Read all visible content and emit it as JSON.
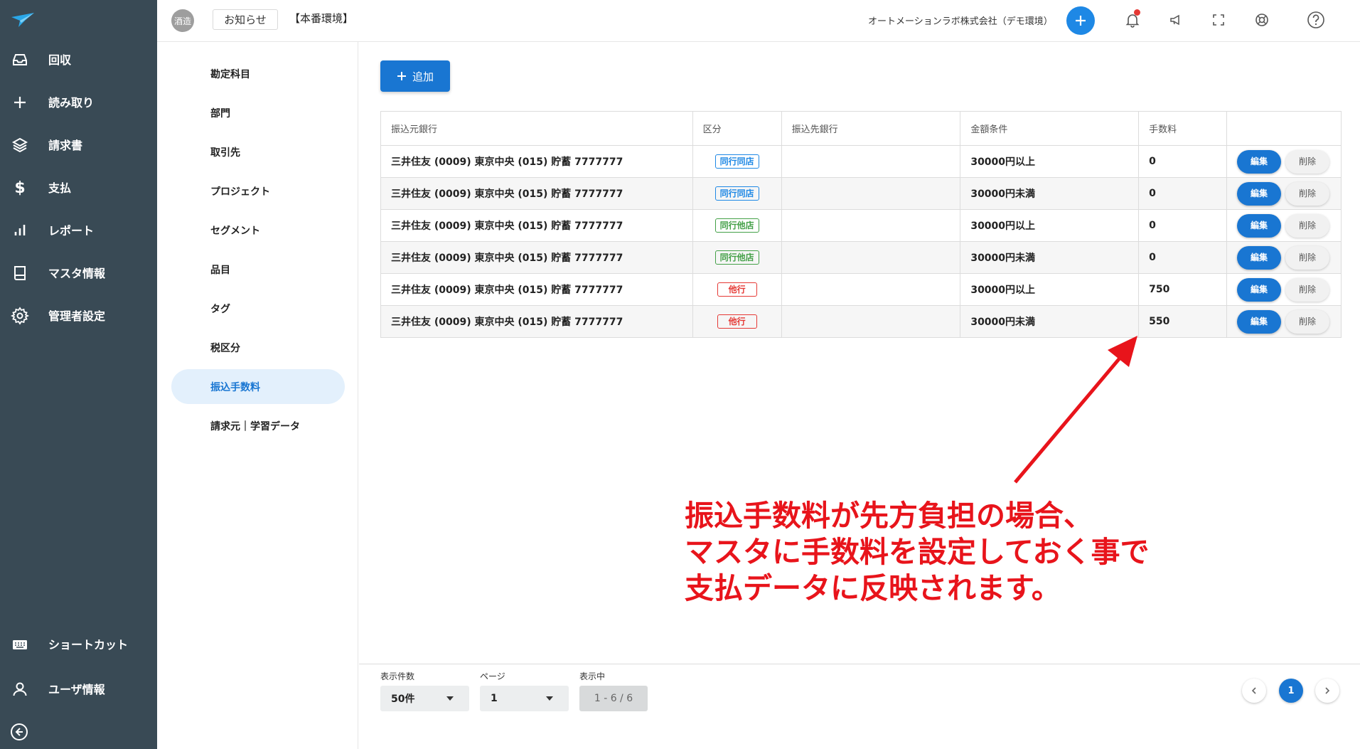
{
  "sidebar": {
    "items": [
      {
        "label": "回収",
        "icon": "inbox-icon"
      },
      {
        "label": "読み取り",
        "icon": "plus-icon"
      },
      {
        "label": "請求書",
        "icon": "layers-icon"
      },
      {
        "label": "支払",
        "icon": "dollar-icon"
      },
      {
        "label": "レポート",
        "icon": "bar-chart-icon"
      },
      {
        "label": "マスタ情報",
        "icon": "book-icon"
      },
      {
        "label": "管理者設定",
        "icon": "gear-icon"
      }
    ],
    "bottom_items": [
      {
        "label": "ショートカット",
        "icon": "keyboard-icon"
      },
      {
        "label": "ユーザ情報",
        "icon": "user-icon"
      }
    ]
  },
  "header": {
    "org_avatar": "酒造",
    "notice_label": "お知らせ",
    "environment": "【本番環境】",
    "company": "オートメーションラボ株式会社（デモ環境）"
  },
  "submenu": {
    "items": [
      {
        "label": "勘定科目"
      },
      {
        "label": "部門"
      },
      {
        "label": "取引先"
      },
      {
        "label": "プロジェクト"
      },
      {
        "label": "セグメント"
      },
      {
        "label": "品目"
      },
      {
        "label": "タグ"
      },
      {
        "label": "税区分"
      },
      {
        "label": "振込手数料"
      },
      {
        "label": "請求元｜学習データ"
      }
    ],
    "active_index": 8
  },
  "main": {
    "add_label": "追加",
    "table": {
      "headers": [
        "振込元銀行",
        "区分",
        "振込先銀行",
        "金額条件",
        "手数料",
        ""
      ],
      "rows": [
        {
          "source_bank": "三井住友 (0009) 東京中央 (015) 貯蓄 7777777",
          "category": "同行同店",
          "category_color": "blue",
          "dest_bank": "",
          "amount_condition": "30000円以上",
          "fee": "0"
        },
        {
          "source_bank": "三井住友 (0009) 東京中央 (015) 貯蓄 7777777",
          "category": "同行同店",
          "category_color": "blue",
          "dest_bank": "",
          "amount_condition": "30000円未満",
          "fee": "0"
        },
        {
          "source_bank": "三井住友 (0009) 東京中央 (015) 貯蓄 7777777",
          "category": "同行他店",
          "category_color": "green",
          "dest_bank": "",
          "amount_condition": "30000円以上",
          "fee": "0"
        },
        {
          "source_bank": "三井住友 (0009) 東京中央 (015) 貯蓄 7777777",
          "category": "同行他店",
          "category_color": "green",
          "dest_bank": "",
          "amount_condition": "30000円未満",
          "fee": "0"
        },
        {
          "source_bank": "三井住友 (0009) 東京中央 (015) 貯蓄 7777777",
          "category": "他行",
          "category_color": "red",
          "dest_bank": "",
          "amount_condition": "30000円以上",
          "fee": "750"
        },
        {
          "source_bank": "三井住友 (0009) 東京中央 (015) 貯蓄 7777777",
          "category": "他行",
          "category_color": "red",
          "dest_bank": "",
          "amount_condition": "30000円未満",
          "fee": "550"
        }
      ],
      "edit_label": "編集",
      "delete_label": "削除"
    }
  },
  "annotation": {
    "text": "振込手数料が先方負担の場合、\nマスタに手数料を設定しておく事で\n支払データに反映されます。",
    "color": "#e8141b"
  },
  "footer": {
    "per_page_label": "表示件数",
    "per_page_value": "50件",
    "page_label": "ページ",
    "page_value": "1",
    "showing_label": "表示中",
    "showing_value": "1 - 6 / 6",
    "current_page": "1"
  },
  "colors": {
    "sidebar_bg": "#394a55",
    "accent": "#1976d2"
  }
}
